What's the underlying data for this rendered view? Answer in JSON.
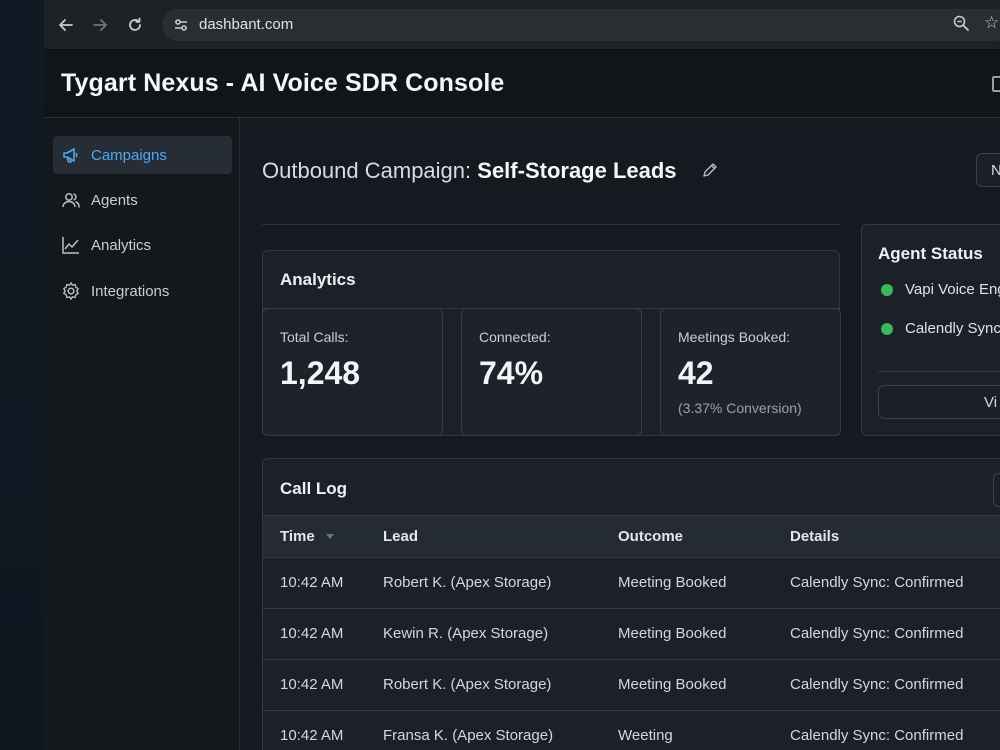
{
  "browser": {
    "url": "dashbant.com",
    "icons": [
      "back-arrow-icon",
      "forward-arrow-icon",
      "reload-icon",
      "site-settings-icon",
      "zoom-icon",
      "bookmark-star-icon"
    ]
  },
  "app": {
    "title": "Tygart Nexus - AI Voice SDR Console"
  },
  "sidebar": {
    "items": [
      {
        "label": "Campaigns",
        "icon": "megaphone-icon",
        "active": true
      },
      {
        "label": "Agents",
        "icon": "users-icon",
        "active": false
      },
      {
        "label": "Analytics",
        "icon": "line-chart-icon",
        "active": false
      },
      {
        "label": "Integrations",
        "icon": "gear-icon",
        "active": false
      }
    ]
  },
  "main": {
    "heading_prefix": "Outbound Campaign:",
    "heading_name": "Self-Storage Leads",
    "top_button_label": "N",
    "analytics": {
      "title": "Analytics",
      "stats": [
        {
          "label": "Total Calls:",
          "value": "1,248",
          "sub": ""
        },
        {
          "label": "Connected:",
          "value": "74%",
          "sub": ""
        },
        {
          "label": "Meetings Booked:",
          "value": "42",
          "sub": "(3.37% Conversion)"
        }
      ]
    },
    "agent_status": {
      "title": "Agent Status",
      "agents": [
        {
          "name": "Vapi Voice Eng",
          "status_color": "#3bb85a"
        },
        {
          "name": "Calendly Sync",
          "status_color": "#3bb85a"
        }
      ],
      "button_label": "Vi"
    },
    "call_log": {
      "title": "Call Log",
      "columns": [
        "Time",
        "Lead",
        "Outcome",
        "Details"
      ],
      "rows": [
        {
          "time": "10:42 AM",
          "lead": "Robert K. (Apex Storage)",
          "outcome": "Meeting Booked",
          "details": "Calendly Sync: Confirmed"
        },
        {
          "time": "10:42 AM",
          "lead": "Kewin R. (Apex Storage)",
          "outcome": "Meeting Booked",
          "details": "Calendly Sync: Confirmed"
        },
        {
          "time": "10:42 AM",
          "lead": "Robert K. (Apex Storage)",
          "outcome": "Meeting Booked",
          "details": "Calendly Sync: Confirmed"
        },
        {
          "time": "10:42 AM",
          "lead": "Fransa K. (Apex Storage)",
          "outcome": "Weeting",
          "details": "Calendly Sync: Confirmed"
        }
      ]
    }
  },
  "colors": {
    "accent": "#3d9be9",
    "status_green": "#3bb85a",
    "background": "#15191f"
  }
}
